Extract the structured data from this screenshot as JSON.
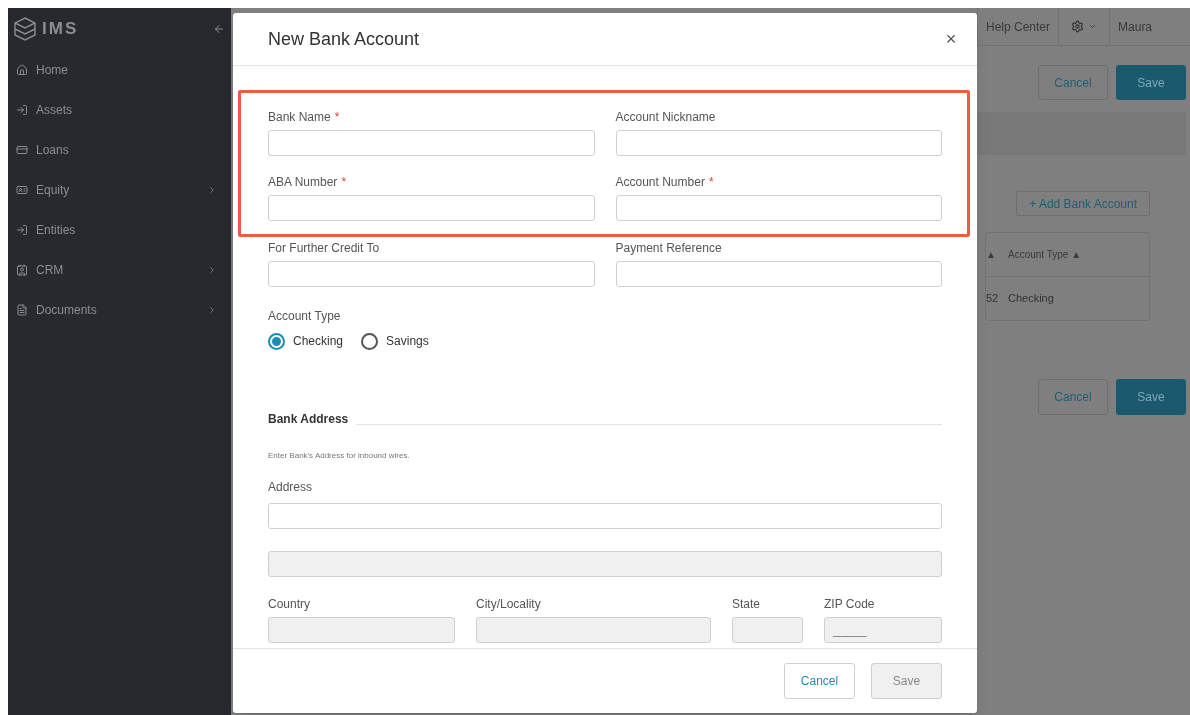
{
  "sidebar": {
    "logo": "IMS",
    "items": [
      {
        "label": "Home",
        "has_submenu": false
      },
      {
        "label": "Assets",
        "has_submenu": false
      },
      {
        "label": "Loans",
        "has_submenu": false
      },
      {
        "label": "Equity",
        "has_submenu": true
      },
      {
        "label": "Entities",
        "has_submenu": false
      },
      {
        "label": "CRM",
        "has_submenu": true
      },
      {
        "label": "Documents",
        "has_submenu": true
      }
    ]
  },
  "topbar": {
    "help": "Help Center",
    "user": "Maura"
  },
  "page": {
    "top_buttons": [
      "Cancel",
      "Save"
    ],
    "add_button": "+ Add Bank Account",
    "table": {
      "columns": [
        "▲",
        "Account Type ▲"
      ],
      "rows": [
        [
          "52",
          "Checking"
        ]
      ]
    },
    "bottom_buttons": [
      "Cancel",
      "Save"
    ]
  },
  "modal": {
    "title": "New Bank Account",
    "close": "×",
    "highlighted_fields": [
      {
        "label": "Bank Name",
        "required_mark": "*",
        "disabled": false
      },
      {
        "label": "Account Nickname",
        "disabled": false
      },
      {
        "label": "ABA Number",
        "required_mark": "*",
        "disabled": false
      },
      {
        "label": "Account Number",
        "required_mark": "*",
        "disabled": false
      }
    ],
    "fields": [
      {
        "label": "For Further Credit To",
        "disabled": false
      },
      {
        "label": "Payment Reference",
        "disabled": false
      }
    ],
    "account_type": {
      "label": "Account Type",
      "options": [
        {
          "label": "Checking",
          "selected": true
        },
        {
          "label": "Savings",
          "selected": false
        }
      ]
    },
    "address_section": {
      "title": "Bank Address",
      "hint": "Enter Bank's Address for inbound wires.",
      "address_label": "Address",
      "address_disabled": false,
      "address2_disabled": true,
      "row": [
        {
          "label": "Country",
          "disabled": true
        },
        {
          "label": "City/Locality",
          "disabled": true
        },
        {
          "label": "State",
          "disabled": true
        },
        {
          "label": "ZIP Code",
          "disabled": true,
          "placeholder": "_____"
        }
      ]
    },
    "buttons": [
      {
        "label": "Cancel",
        "disabled": false
      },
      {
        "label": "Save",
        "disabled": true
      }
    ]
  }
}
